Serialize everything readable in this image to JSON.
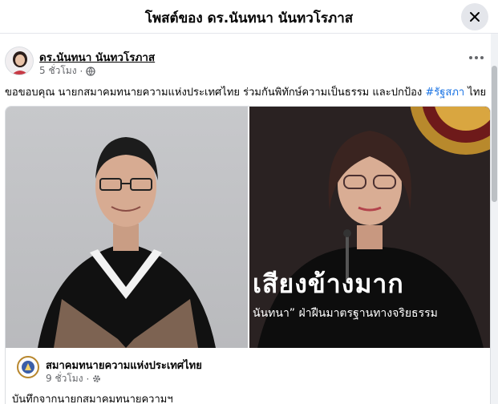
{
  "modal": {
    "title": "โพสต์ของ ดร.นันทนา นันทวโรภาส"
  },
  "post": {
    "author": "ดร.นันทนา นันทวโรภาส",
    "time": "5 ชั่วโมง",
    "separator": "·",
    "audience_icon": "globe-icon",
    "text_before": "ขอขอบคุณ นายกสมาคมทนายความแห่งประเทศไทย ร่วมกันพิทักษ์ความเป็นธรรม และปกป้อง ",
    "hashtag": "#รัฐสภา",
    "text_after": " ไทย"
  },
  "shared_post": {
    "overlay_headline": "เสียงข้างมาก",
    "overlay_caption": "นันทนา” ฝ่าฝืนมาตรฐานทางจริยธรรม",
    "org_name": "สมาคมทนายความแห่งประเทศไทย",
    "time": "9 ชั่วโมง",
    "separator": "·",
    "audience_icon": "gear-icon",
    "text": "บันทึกจากนายกสมาคมทนายความฯ"
  },
  "colors": {
    "hashtag": "#1b74e4",
    "secondary_text": "#65676b"
  }
}
